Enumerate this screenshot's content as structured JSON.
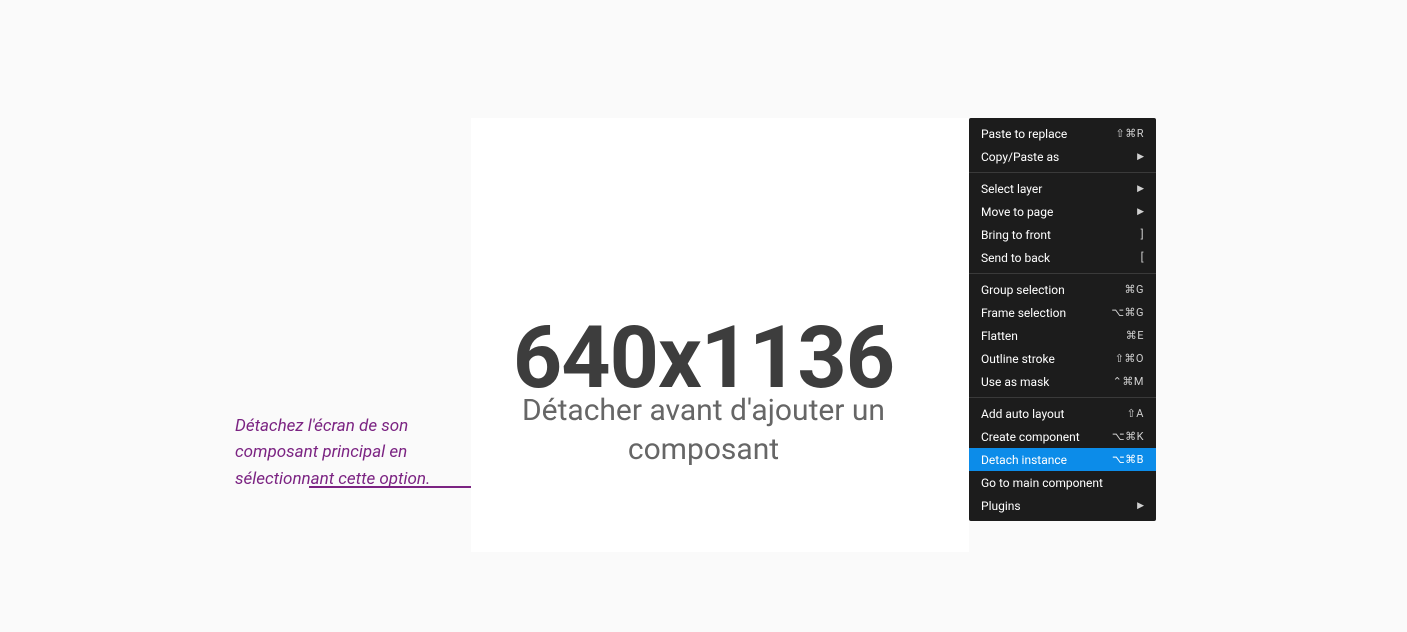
{
  "caption": "Détachez l'écran de son composant principal en sélectionnant cette option.",
  "placeholder": {
    "title": "640x1136",
    "subtitle": "Détacher avant d'ajouter un composant"
  },
  "menu": {
    "groups": [
      [
        {
          "label": "Paste to replace",
          "shortcut": "⇧⌘R"
        },
        {
          "label": "Copy/Paste as",
          "submenu": true
        }
      ],
      [
        {
          "label": "Select layer",
          "submenu": true
        },
        {
          "label": "Move to page",
          "submenu": true
        },
        {
          "label": "Bring to front",
          "shortcut": "]"
        },
        {
          "label": "Send to back",
          "shortcut": "["
        }
      ],
      [
        {
          "label": "Group selection",
          "shortcut": "⌘G"
        },
        {
          "label": "Frame selection",
          "shortcut": "⌥⌘G"
        },
        {
          "label": "Flatten",
          "shortcut": "⌘E"
        },
        {
          "label": "Outline stroke",
          "shortcut": "⇧⌘O"
        },
        {
          "label": "Use as mask",
          "shortcut": "⌃⌘M"
        }
      ],
      [
        {
          "label": "Add auto layout",
          "shortcut": "⇧A"
        },
        {
          "label": "Create component",
          "shortcut": "⌥⌘K"
        },
        {
          "label": "Detach instance",
          "shortcut": "⌥⌘B",
          "highlighted": true
        },
        {
          "label": "Go to main component"
        },
        {
          "label": "Plugins",
          "submenu": true
        }
      ]
    ]
  }
}
